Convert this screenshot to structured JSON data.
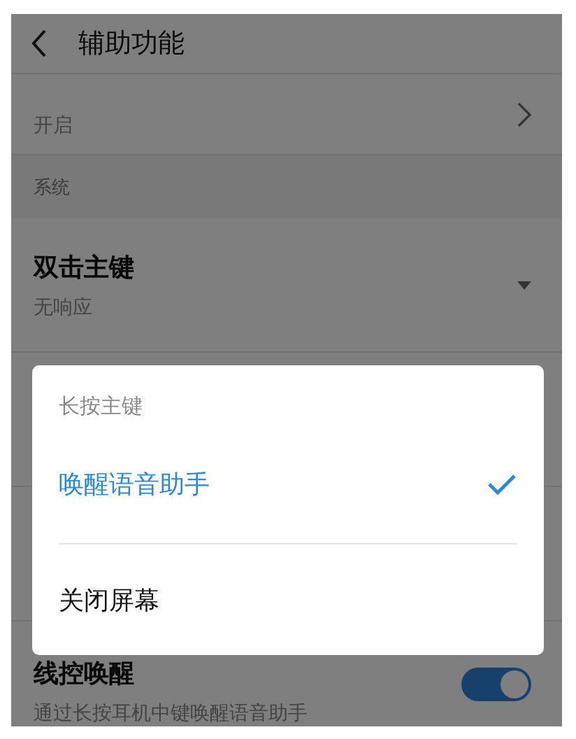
{
  "header": {
    "title": "辅助功能"
  },
  "rows": [
    {
      "kind": "link",
      "subtitle": "开启"
    },
    {
      "kind": "section",
      "title": "系统"
    },
    {
      "kind": "dropdown",
      "title": "双击主键",
      "subtitle": "无响应"
    },
    {
      "kind": "covered"
    },
    {
      "kind": "covered"
    },
    {
      "kind": "switch",
      "title": "线控唤醒",
      "subtitle": "通过长按耳机中键唤醒语音助手",
      "on": true
    }
  ],
  "dialog": {
    "title": "长按主键",
    "options": [
      {
        "label": "唤醒语音助手",
        "selected": true
      },
      {
        "label": "关闭屏幕",
        "selected": false
      }
    ]
  }
}
